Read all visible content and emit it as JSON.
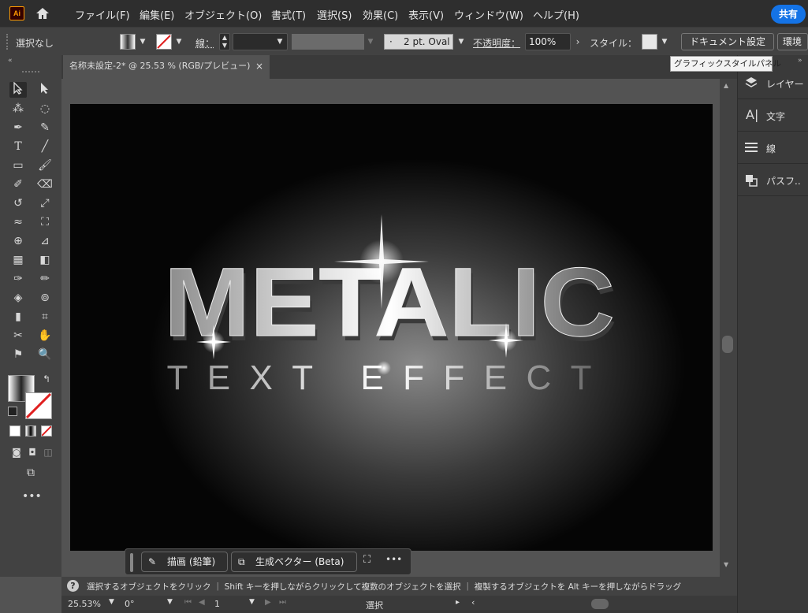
{
  "app": {
    "logo_text": "Ai"
  },
  "menubar": {
    "items": [
      "ファイル(F)",
      "編集(E)",
      "オブジェクト(O)",
      "書式(T)",
      "選択(S)",
      "効果(C)",
      "表示(V)",
      "ウィンドウ(W)",
      "ヘルプ(H)"
    ],
    "share_label": "共有"
  },
  "controlbar": {
    "selection_status": "選択なし",
    "stroke_label": "線：",
    "brush_label": "2 pt. Oval",
    "brush_prefix": "·",
    "opacity_label": "不透明度：",
    "opacity_value": "100%",
    "style_label": "スタイル：",
    "doc_settings_label": "ドキュメント設定",
    "prefs_label": "環境"
  },
  "tooltip": {
    "text": "グラフィックスタイルパネル"
  },
  "document_tab": {
    "title": "名称未設定-2* @ 25.53 % (RGB/プレビュー)",
    "close": "×"
  },
  "artwork": {
    "headline": "METALIC",
    "subline": "TEXT EFFECT"
  },
  "panels": {
    "items": [
      {
        "label": "レイヤー",
        "icon": "layers-icon"
      },
      {
        "label": "文字",
        "icon": "character-icon"
      },
      {
        "label": "線",
        "icon": "stroke-icon"
      },
      {
        "label": "パスフ..",
        "icon": "pathfinder-icon"
      }
    ]
  },
  "floatbar": {
    "draw_label": "描画 (鉛筆)",
    "genvector_label": "生成ベクター (Beta)",
    "more": "•••"
  },
  "statusbar": {
    "hint": "選択するオブジェクトをクリック ｜ Shift キーを押しながらクリックして複数のオブジェクトを選択 ｜ 複製するオブジェクトを Alt キーを押しながらドラッグ"
  },
  "bottombar": {
    "zoom": "25.53%",
    "rotation": "0°",
    "artboard_number": "1",
    "tool_name": "選択"
  },
  "colors": {
    "accent": "#1473e6",
    "ai_logo": "#ff9a00"
  }
}
